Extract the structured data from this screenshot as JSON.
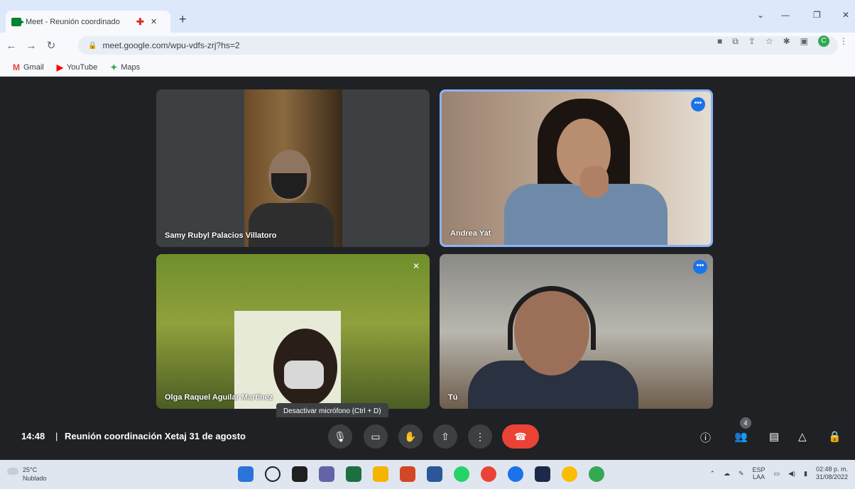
{
  "browser": {
    "tab_title": "Meet - Reunión coordinado",
    "tab_close": "✕",
    "new_tab": "+",
    "url": "meet.google.com/wpu-vdfs-zrj?hs=2",
    "window_minimize": "—",
    "window_maximize": "❐",
    "window_close": "✕",
    "chevron": "⌄",
    "bookmarks": [
      {
        "label": "Gmail",
        "icon": "M",
        "color": "#ea4335"
      },
      {
        "label": "YouTube",
        "icon": "▶",
        "color": "#ff0000"
      },
      {
        "label": "Maps",
        "icon": "✦",
        "color": "#34a853"
      }
    ],
    "profile_initial": "C"
  },
  "meet": {
    "participants": [
      {
        "name": "Samy Rubyl Palacios Villatoro"
      },
      {
        "name": "Andrea Yat"
      },
      {
        "name": "Olga Raquel Aguilar Martínez"
      },
      {
        "name": "Tú"
      }
    ],
    "tooltip": "Desactivar micrófono (Ctrl + D)",
    "time": "14:48",
    "separator": "|",
    "meeting_title": "Reunión coordinación Xetaj 31 de agosto",
    "participant_count": "4"
  },
  "taskbar": {
    "temperature": "25°C",
    "weather": "Nublado",
    "lang_1": "ESP",
    "lang_2": "LAA",
    "time": "02:48 p. m.",
    "date": "31/08/2022"
  },
  "colors": {
    "end_call": "#ea4335",
    "active_border": "#8ab4f8",
    "accent": "#1a73e8"
  }
}
